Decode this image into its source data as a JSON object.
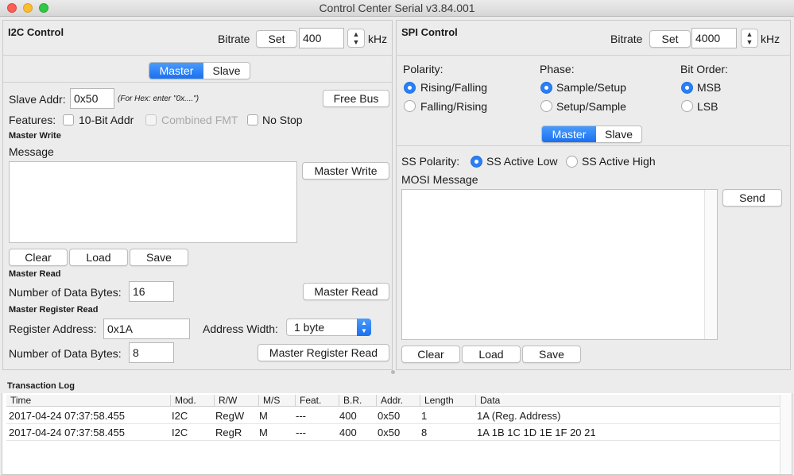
{
  "window": {
    "title": "Control Center Serial v3.84.001"
  },
  "i2c": {
    "header": "I2C Control",
    "bitrate_label": "Bitrate",
    "set_label": "Set",
    "bitrate_value": "400",
    "unit": "kHz",
    "mode_tabs": [
      "Master",
      "Slave"
    ],
    "slave_addr_label": "Slave Addr:",
    "slave_addr_value": "0x50",
    "hex_hint": "(For Hex: enter \"0x....\")",
    "free_bus_label": "Free Bus",
    "features_label": "Features:",
    "feature_10bit": "10-Bit Addr",
    "feature_combined": "Combined FMT",
    "feature_nostop": "No Stop",
    "master_write_header": "Master Write",
    "message_label": "Message",
    "master_write_button": "Master Write",
    "clear_label": "Clear",
    "load_label": "Load",
    "save_label": "Save",
    "master_read_header": "Master Read",
    "num_bytes_label": "Number of Data Bytes:",
    "num_bytes_value": "16",
    "master_read_button": "Master Read",
    "reg_read_header": "Master Register Read",
    "reg_addr_label": "Register Address:",
    "reg_addr_value": "0x1A",
    "addr_width_label": "Address Width:",
    "addr_width_value": "1 byte",
    "reg_num_bytes_label": "Number of Data Bytes:",
    "reg_num_bytes_value": "8",
    "reg_read_button": "Master Register Read"
  },
  "spi": {
    "header": "SPI Control",
    "bitrate_label": "Bitrate",
    "set_label": "Set",
    "bitrate_value": "4000",
    "unit": "kHz",
    "polarity_label": "Polarity:",
    "polarity_opt1": "Rising/Falling",
    "polarity_opt2": "Falling/Rising",
    "phase_label": "Phase:",
    "phase_opt1": "Sample/Setup",
    "phase_opt2": "Setup/Sample",
    "bitorder_label": "Bit Order:",
    "bitorder_opt1": "MSB",
    "bitorder_opt2": "LSB",
    "mode_tabs": [
      "Master",
      "Slave"
    ],
    "ss_polarity_label": "SS Polarity:",
    "ss_low": "SS Active Low",
    "ss_high": "SS Active High",
    "mosi_label": "MOSI Message",
    "send_label": "Send",
    "clear_label": "Clear",
    "load_label": "Load",
    "save_label": "Save"
  },
  "log": {
    "header": "Transaction Log",
    "columns": [
      "Time",
      "Mod.",
      "R/W",
      "M/S",
      "Feat.",
      "B.R.",
      "Addr.",
      "Length",
      "Data"
    ],
    "rows": [
      [
        "2017-04-24 07:37:58.455",
        "I2C",
        "RegW",
        "M",
        "---",
        "400",
        "0x50",
        "1",
        "1A (Reg. Address)"
      ],
      [
        "2017-04-24 07:37:58.455",
        "I2C",
        "RegR",
        "M",
        "---",
        "400",
        "0x50",
        "8",
        "1A 1B 1C 1D 1E 1F 20 21"
      ]
    ]
  },
  "colors": {
    "accent": "#2a7ff6",
    "close": "#fc5f57",
    "minimize": "#fdbc2e",
    "zoom": "#33c748"
  }
}
